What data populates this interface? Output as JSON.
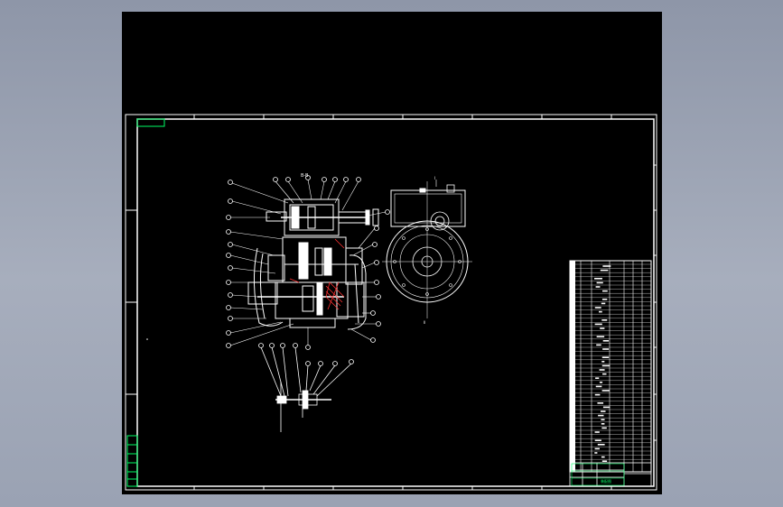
{
  "viewer": {
    "background_color": "#000000",
    "frame_color": "#ffffff",
    "accent_color": "#00ff66",
    "hatch_color": "#ff3030"
  },
  "drawing": {
    "main_view_top_label": "B-B",
    "side_view_top_label": "I",
    "side_view_bottom_label": "II",
    "title_block_code": "装配图"
  }
}
